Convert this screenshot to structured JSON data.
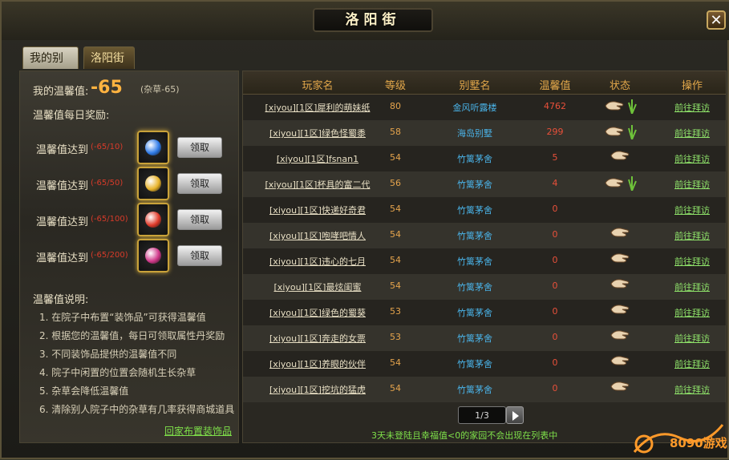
{
  "window": {
    "title": "洛阳街",
    "close_label": "✕"
  },
  "tabs": [
    {
      "label": "我的别墅"
    },
    {
      "label": "洛阳街"
    }
  ],
  "left": {
    "warmth_label": "我的温馨值:",
    "warmth_value": "-65",
    "warmth_note": "(杂草-65)",
    "daily_title": "温馨值每日奖励:",
    "rewards": [
      {
        "label": "温馨值达到",
        "req": "(-65/10)",
        "gem_color": "#2f7be8",
        "button": "领取"
      },
      {
        "label": "温馨值达到",
        "req": "(-65/50)",
        "gem_color": "#e8b32a",
        "button": "领取"
      },
      {
        "label": "温馨值达到",
        "req": "(-65/100)",
        "gem_color": "#e03a2a",
        "button": "领取"
      },
      {
        "label": "温馨值达到",
        "req": "(-65/200)",
        "gem_color": "#d0388a",
        "button": "领取"
      }
    ],
    "desc_title": "温馨值说明:",
    "desc_items": [
      "1. 在院子中布置“装饰品”可获得温馨值",
      "2. 根据您的温馨值，每日可领取属性丹奖励",
      "3. 不同装饰品提供的温馨值不同",
      "4. 院子中闲置的位置会随机生长杂草",
      "5. 杂草会降低温馨值",
      "6. 清除别人院子中的杂草有几率获得商城道具"
    ],
    "decorate_link": "回家布置装饰品"
  },
  "table": {
    "headers": [
      "玩家名",
      "等级",
      "别墅名",
      "温馨值",
      "状态",
      "操作"
    ],
    "rows": [
      {
        "name": "[xiyou][1区]犀利的萌妹纸",
        "level": "80",
        "villa": "金风听露楼",
        "warmth": "4762",
        "hand": true,
        "grass": true,
        "op": "前往拜访"
      },
      {
        "name": "[xiyou][1区]绿色怪蜀黍",
        "level": "58",
        "villa": "海岛别墅",
        "warmth": "299",
        "hand": true,
        "grass": true,
        "op": "前往拜访"
      },
      {
        "name": "[xiyou][1区]fsnan1",
        "level": "54",
        "villa": "竹篱茅舍",
        "warmth": "5",
        "hand": true,
        "grass": false,
        "op": "前往拜访"
      },
      {
        "name": "[xiyou][1区]杯具的富二代",
        "level": "56",
        "villa": "竹篱茅舍",
        "warmth": "4",
        "hand": true,
        "grass": true,
        "op": "前往拜访"
      },
      {
        "name": "[xiyou][1区]快递好奇君",
        "level": "54",
        "villa": "竹篱茅舍",
        "warmth": "0",
        "hand": false,
        "grass": false,
        "op": "前往拜访"
      },
      {
        "name": "[xiyou][1区]咆哮吧情人",
        "level": "54",
        "villa": "竹篱茅舍",
        "warmth": "0",
        "hand": true,
        "grass": false,
        "op": "前往拜访"
      },
      {
        "name": "[xiyou][1区]违心的七月",
        "level": "54",
        "villa": "竹篱茅舍",
        "warmth": "0",
        "hand": true,
        "grass": false,
        "op": "前往拜访"
      },
      {
        "name": "[xiyou][1区]最炫闺蜜",
        "level": "54",
        "villa": "竹篱茅舍",
        "warmth": "0",
        "hand": true,
        "grass": false,
        "op": "前往拜访"
      },
      {
        "name": "[xiyou][1区]绿色的蜀葵",
        "level": "53",
        "villa": "竹篱茅舍",
        "warmth": "0",
        "hand": true,
        "grass": false,
        "op": "前往拜访"
      },
      {
        "name": "[xiyou][1区]奔走的女票",
        "level": "53",
        "villa": "竹篱茅舍",
        "warmth": "0",
        "hand": true,
        "grass": false,
        "op": "前往拜访"
      },
      {
        "name": "[xiyou][1区]养眼的伙伴",
        "level": "54",
        "villa": "竹篱茅舍",
        "warmth": "0",
        "hand": true,
        "grass": false,
        "op": "前往拜访"
      },
      {
        "name": "[xiyou][1区]挖坑的猛虎",
        "level": "54",
        "villa": "竹篱茅舍",
        "warmth": "0",
        "hand": true,
        "grass": false,
        "op": "前往拜访"
      }
    ]
  },
  "pager": {
    "text": "1/3"
  },
  "footnote": "3天未登陆且幸福值<0的家园不会出现在列表中",
  "watermark": {
    "text": "8090游戏"
  }
}
